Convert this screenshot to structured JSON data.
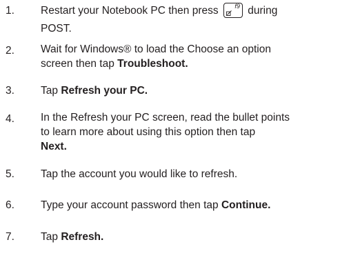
{
  "steps": [
    {
      "number": "1.",
      "before_key": "Restart your Notebook PC then press",
      "key_label": "f9",
      "after_key": "during",
      "line2": "POST."
    },
    {
      "number": "2.",
      "line1": "Wait for Windows® to load the Choose an option",
      "line2_plain": "screen then tap",
      "line2_bold": "Troubleshoot."
    },
    {
      "number": "3.",
      "plain": "Tap",
      "bold": "Refresh your PC."
    },
    {
      "number": "4.",
      "line1": "In the Refresh your PC screen, read the bullet points",
      "line2": "to learn more about using this option then tap",
      "line3_bold": "Next."
    },
    {
      "number": "5.",
      "plain": "Tap the account you would like to refresh."
    },
    {
      "number": "6.",
      "plain": "Type your account password then tap",
      "bold": "Continue."
    },
    {
      "number": "7.",
      "plain": "Tap",
      "bold": "Refresh."
    }
  ]
}
